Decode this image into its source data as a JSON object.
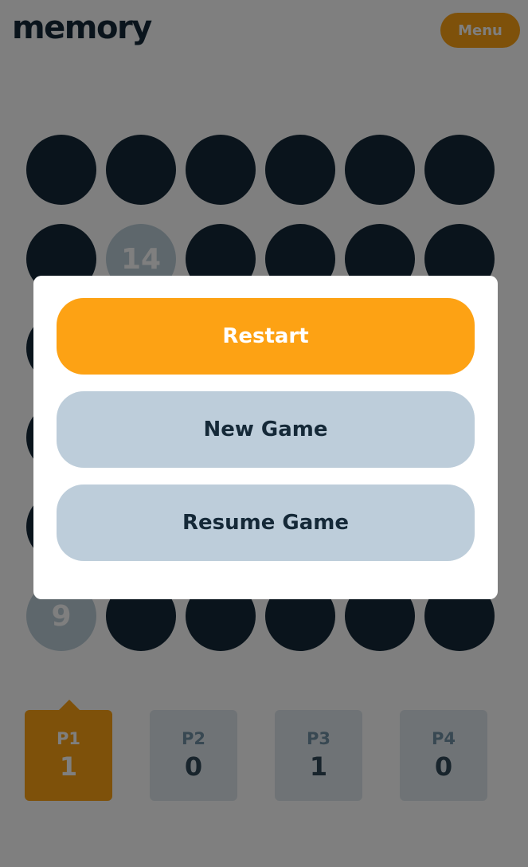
{
  "header": {
    "logo": "memory",
    "menu_label": "Menu"
  },
  "board": {
    "rows": 6,
    "columns": 6,
    "cells": [
      "",
      "",
      "",
      "",
      "",
      "",
      "",
      "14",
      "",
      "",
      "",
      "",
      "",
      "",
      "",
      "",
      "",
      "",
      "",
      "",
      "",
      "",
      "",
      "",
      "",
      "",
      "",
      "",
      "",
      "",
      "9",
      "",
      "",
      "",
      "",
      ""
    ]
  },
  "players": [
    {
      "label": "P1",
      "score": "1",
      "active": true
    },
    {
      "label": "P2",
      "score": "0",
      "active": false
    },
    {
      "label": "P3",
      "score": "1",
      "active": false
    },
    {
      "label": "P4",
      "score": "0",
      "active": false
    }
  ],
  "modal": {
    "restart_label": "Restart",
    "new_game_label": "New Game",
    "resume_label": "Resume Game"
  },
  "colors": {
    "accent": "#fda214",
    "dark": "#152938",
    "revealed": "#bcced9",
    "button_secondary": "#bdcdda"
  }
}
